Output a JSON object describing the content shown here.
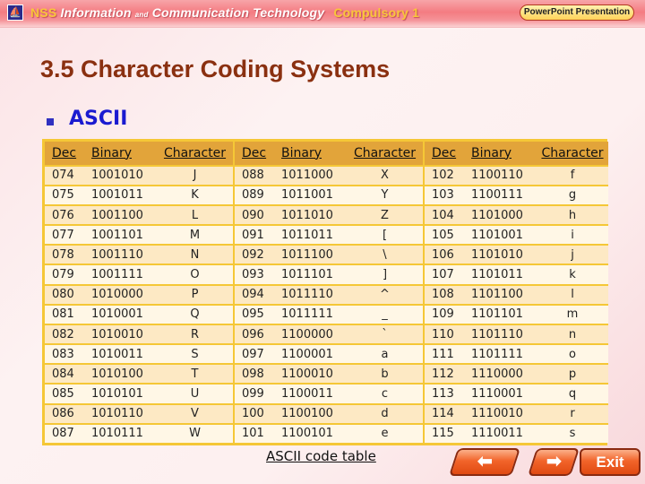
{
  "header": {
    "logo_icon": "ship-logo-icon",
    "brand_nss": "NSS",
    "brand_info": "Information",
    "brand_and": "and",
    "brand_ict": "Communication Technology",
    "brand_compulsory": "Compulsory 1",
    "badge": "PowerPoint Presentation"
  },
  "page": {
    "title": "3.5  Character Coding Systems",
    "section": "ASCII",
    "caption": "ASCII code table"
  },
  "table": {
    "headers": [
      "Dec",
      "Binary",
      "Character"
    ],
    "groups": [
      [
        [
          "074",
          "1001010",
          "J"
        ],
        [
          "075",
          "1001011",
          "K"
        ],
        [
          "076",
          "1001100",
          "L"
        ],
        [
          "077",
          "1001101",
          "M"
        ],
        [
          "078",
          "1001110",
          "N"
        ],
        [
          "079",
          "1001111",
          "O"
        ],
        [
          "080",
          "1010000",
          "P"
        ],
        [
          "081",
          "1010001",
          "Q"
        ],
        [
          "082",
          "1010010",
          "R"
        ],
        [
          "083",
          "1010011",
          "S"
        ],
        [
          "084",
          "1010100",
          "T"
        ],
        [
          "085",
          "1010101",
          "U"
        ],
        [
          "086",
          "1010110",
          "V"
        ],
        [
          "087",
          "1010111",
          "W"
        ]
      ],
      [
        [
          "088",
          "1011000",
          "X"
        ],
        [
          "089",
          "1011001",
          "Y"
        ],
        [
          "090",
          "1011010",
          "Z"
        ],
        [
          "091",
          "1011011",
          "["
        ],
        [
          "092",
          "1011100",
          "\\"
        ],
        [
          "093",
          "1011101",
          "]"
        ],
        [
          "094",
          "1011110",
          "^"
        ],
        [
          "095",
          "1011111",
          "_"
        ],
        [
          "096",
          "1100000",
          "`"
        ],
        [
          "097",
          "1100001",
          "a"
        ],
        [
          "098",
          "1100010",
          "b"
        ],
        [
          "099",
          "1100011",
          "c"
        ],
        [
          "100",
          "1100100",
          "d"
        ],
        [
          "101",
          "1100101",
          "e"
        ]
      ],
      [
        [
          "102",
          "1100110",
          "f"
        ],
        [
          "103",
          "1100111",
          "g"
        ],
        [
          "104",
          "1101000",
          "h"
        ],
        [
          "105",
          "1101001",
          "i"
        ],
        [
          "106",
          "1101010",
          "j"
        ],
        [
          "107",
          "1101011",
          "k"
        ],
        [
          "108",
          "1101100",
          "l"
        ],
        [
          "109",
          "1101101",
          "m"
        ],
        [
          "110",
          "1101110",
          "n"
        ],
        [
          "111",
          "1101111",
          "o"
        ],
        [
          "112",
          "1110000",
          "p"
        ],
        [
          "113",
          "1110001",
          "q"
        ],
        [
          "114",
          "1110010",
          "r"
        ],
        [
          "115",
          "1110011",
          "s"
        ]
      ]
    ]
  },
  "nav": {
    "prev_icon": "arrow-left-icon",
    "prev_glyph": "⬅",
    "next_icon": "arrow-right-icon",
    "next_glyph": "➡",
    "exit_label": "Exit"
  },
  "colors": {
    "title": "#8a3010",
    "section": "#1a1ad0",
    "table_border": "#f5c736",
    "table_header": "#e2a43a"
  }
}
